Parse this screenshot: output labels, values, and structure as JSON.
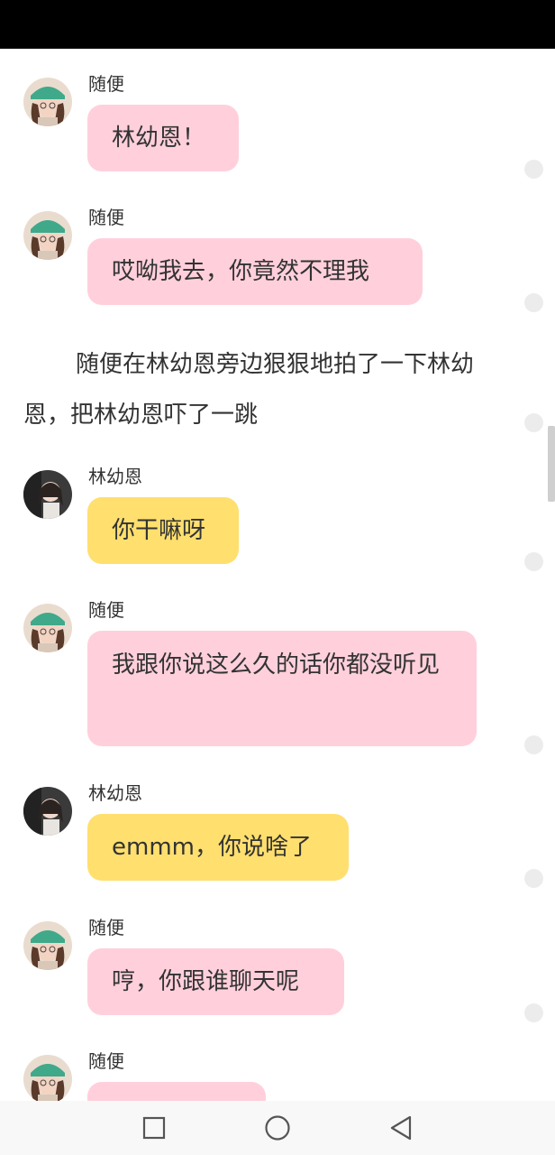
{
  "messages": [
    {
      "sender": "随便",
      "text": "林幼恩！",
      "role": "pink"
    },
    {
      "sender": "随便",
      "text": "哎呦我去，你竟然不理我",
      "role": "pink"
    },
    {
      "narration": "随便在林幼恩旁边狠狠地拍了一下林幼恩，把林幼恩吓了一跳"
    },
    {
      "sender": "林幼恩",
      "text": "你干嘛呀",
      "role": "yellow"
    },
    {
      "sender": "随便",
      "text": "我跟你说这么久的话你都没听见",
      "role": "pink"
    },
    {
      "sender": "林幼恩",
      "text": "emmm，你说啥了",
      "role": "yellow"
    },
    {
      "sender": "随便",
      "text": "哼，你跟谁聊天呢",
      "role": "pink"
    },
    {
      "sender": "随便",
      "text": "",
      "role": "pink"
    }
  ],
  "colors": {
    "pink_bubble": "#ffd0dc",
    "yellow_bubble": "#ffdf6e",
    "status_bar": "#000000"
  },
  "navbar": {
    "icons": [
      "recent-apps-icon",
      "home-icon",
      "back-icon"
    ]
  }
}
